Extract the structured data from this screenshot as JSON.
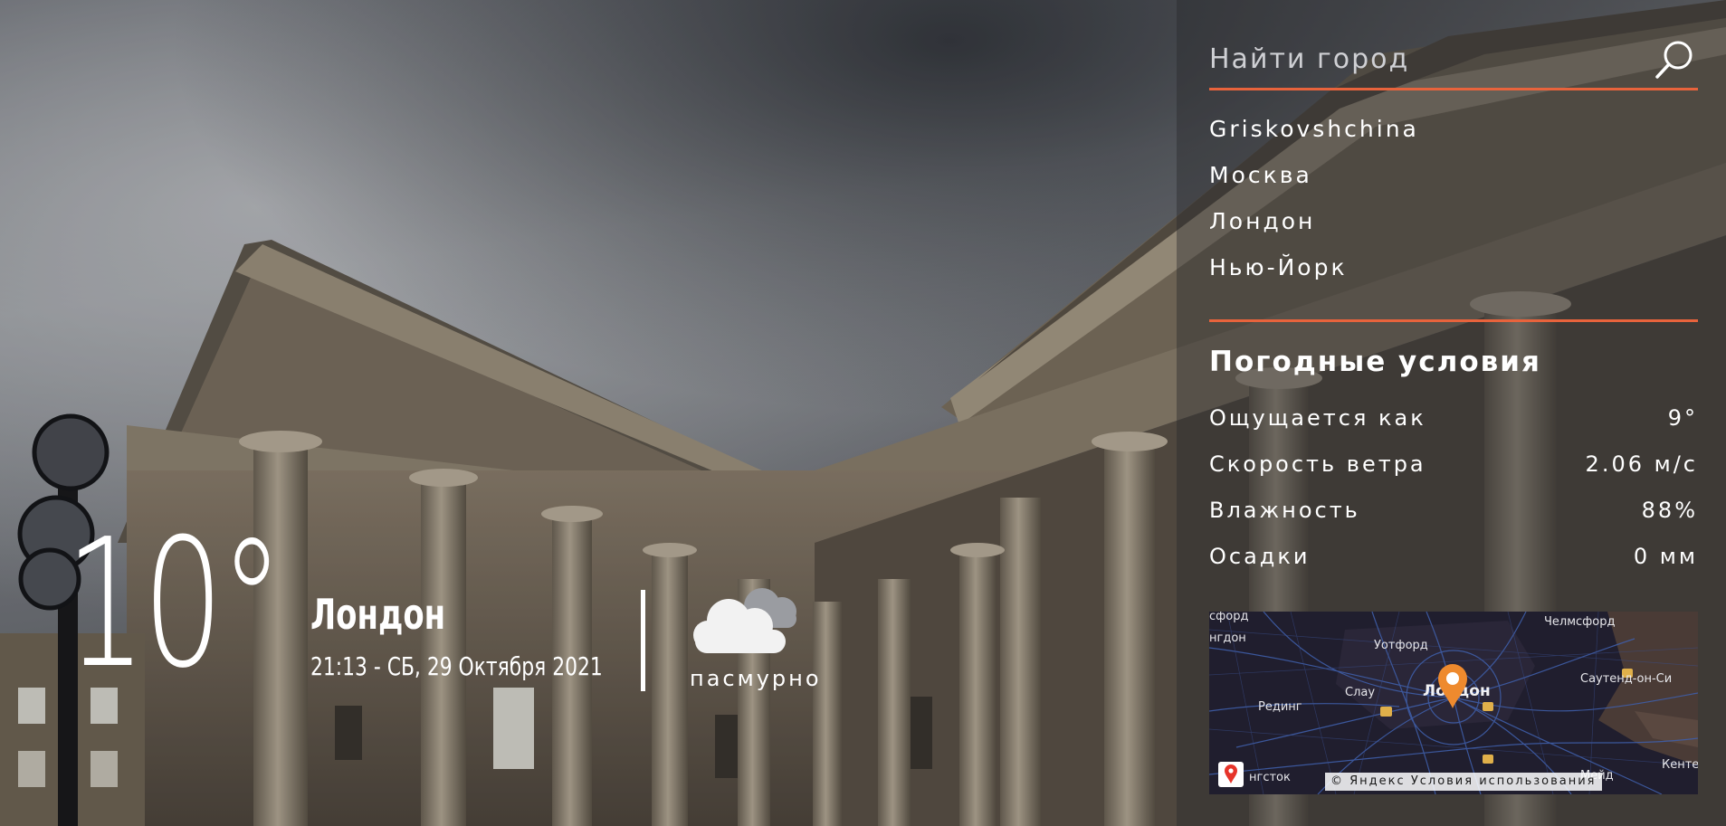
{
  "weather": {
    "temperature": "10°",
    "city": "Лондон",
    "datetime": "21:13 - СБ, 29 Октября 2021",
    "condition": "пасмурно",
    "condition_icon": "cloud-icon"
  },
  "search": {
    "placeholder": "Найти город",
    "icon": "search-icon"
  },
  "recent_cities": [
    "Griskovshchina",
    "Москва",
    "Лондон",
    "Нью-Йорк"
  ],
  "conditions": {
    "title": "Погодные условия",
    "rows": [
      {
        "label": "Ощущается как",
        "value": "9°"
      },
      {
        "label": "Скорость ветра",
        "value": "2.06 м/с"
      },
      {
        "label": "Влажность",
        "value": "88%"
      },
      {
        "label": "Осадки",
        "value": "0 мм"
      }
    ]
  },
  "map": {
    "labels": [
      "сфорд",
      "нгдон",
      "Уотфорд",
      "Челмсфорд",
      "Саутенд-он-Си",
      "Слау",
      "Рединг",
      "нгсток",
      "Лондон",
      "Кенте",
      "Мейд"
    ],
    "copyright": "©",
    "yandex": "Яндекс",
    "terms": "Условия использования"
  },
  "colors": {
    "accent": "#e8633c",
    "panel": "#28282c"
  }
}
